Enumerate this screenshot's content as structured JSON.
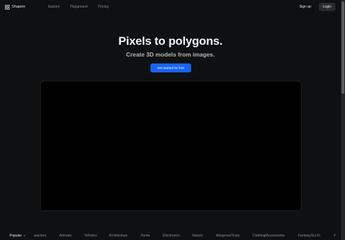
{
  "nav": {
    "brand": "Shapen",
    "links": [
      "Explore",
      "Playground",
      "Pricing"
    ],
    "signup": "Sign up",
    "login": "Login"
  },
  "hero": {
    "title": "Pixels to polygons.",
    "subtitle": "Create 3D models from images.",
    "cta": "Get started for free"
  },
  "categories": {
    "selected": "Popular",
    "items": [
      "aracters",
      "Animals",
      "Vehicles",
      "Architecture",
      "Home",
      "Electronics",
      "Nature",
      "Weapons/Tools",
      "Clothing/Accessories",
      "Fantasy/Sci-Fi",
      "F"
    ]
  },
  "colors": {
    "background": "#0f1011",
    "accent": "#1864f2",
    "viewer": "#000000"
  }
}
